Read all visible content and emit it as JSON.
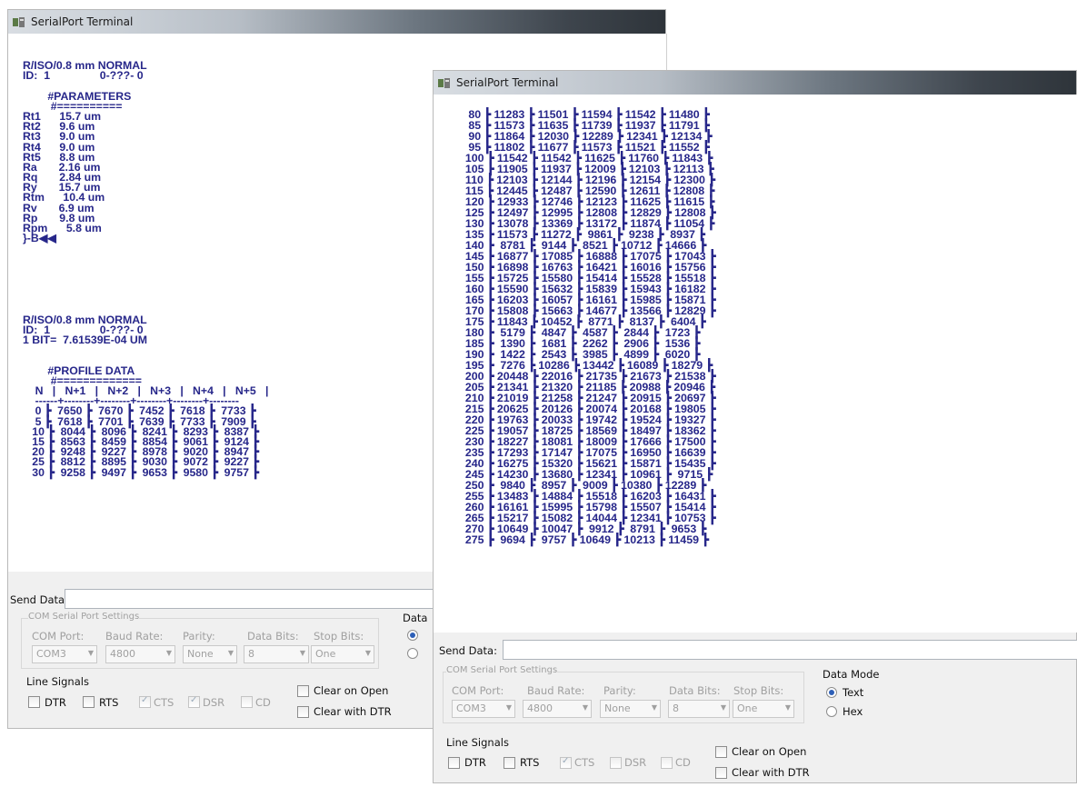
{
  "window1": {
    "title": "SerialPort Terminal",
    "terminal_lines": [
      "R/ISO/0.8 mm NORMAL",
      "ID:  1                0-???- 0",
      "",
      "        #PARAMETERS",
      "         #==========",
      "Rt1      15.7 um",
      "Rt2      9.6 um",
      "Rt3      9.0 um",
      "Rt4      9.0 um",
      "Rt5      8.8 um",
      "Ra       2.16 um",
      "Rq       2.84 um",
      "Ry       15.7 um",
      "Rtm      10.4 um",
      "Rv       6.9 um",
      "Rp       9.8 um",
      "Rpm      5.8 um",
      "}-B◀◀",
      "",
      "",
      "",
      "",
      "",
      "",
      "",
      "R/ISO/0.8 mm NORMAL",
      "ID:  1                0-???- 0",
      "1 BIT=  7.61539E-04 UM",
      "",
      "",
      "        #PROFILE DATA",
      "         #=============",
      "    N   |   N+1   |   N+2   |   N+3   |   N+4   |   N+5   |",
      "    ------+--------+--------+--------+--------+--------",
      "    0 ┣  7650 ┣  7670 ┣  7452 ┣  7618 ┣  7733 ┣",
      "    5 ┣  7618 ┣  7701 ┣  7639 ┣  7733 ┣  7909 ┣",
      "   10 ┣  8044 ┣  8096 ┣  8241 ┣  8293 ┣  8387 ┣",
      "   15 ┣  8563 ┣  8459 ┣  8854 ┣  9061 ┣  9124 ┣",
      "   20 ┣  9248 ┣  9227 ┣  8978 ┣  9020 ┣  8947 ┣",
      "   25 ┣  8812 ┣  8895 ┣  9030 ┣  9072 ┣  9227 ┣",
      "   30 ┣  9258 ┣  9497 ┣  9653 ┣  9580 ┣  9757 ┣"
    ],
    "send_data_label": "Send Data:",
    "com_group_label": "COM Serial Port Settings",
    "com_port_label": "COM Port:",
    "com_port_value": "COM3",
    "baud_label": "Baud Rate:",
    "baud_value": "4800",
    "parity_label": "Parity:",
    "parity_value": "None",
    "databits_label": "Data Bits:",
    "databits_value": "8",
    "stopbits_label": "Stop Bits:",
    "stopbits_value": "One",
    "data_mode_label": "Data",
    "line_signals_label": "Line Signals",
    "dtr": "DTR",
    "rts": "RTS",
    "cts": "CTS",
    "dsr": "DSR",
    "cd": "CD",
    "clear_open": "Clear on Open",
    "clear_dtr": "Clear with DTR"
  },
  "window2": {
    "title": "SerialPort Terminal",
    "terminal_lines": [
      "   80 ┣ 11283 ┣ 11501 ┣ 11594 ┣ 11542 ┣ 11480 ┣",
      "   85 ┣ 11573 ┣ 11635 ┣ 11739 ┣ 11937 ┣ 11791 ┣",
      "   90 ┣ 11864 ┣ 12030 ┣ 12289 ┣ 12341 ┣ 12134 ┣",
      "   95 ┣ 11802 ┣ 11677 ┣ 11573 ┣ 11521 ┣ 11552 ┣",
      "  100 ┣ 11542 ┣ 11542 ┣ 11625 ┣ 11760 ┣ 11843 ┣",
      "  105 ┣ 11905 ┣ 11937 ┣ 12009 ┣ 12103 ┣ 12113 ┣",
      "  110 ┣ 12103 ┣ 12144 ┣ 12196 ┣ 12154 ┣ 12300 ┣",
      "  115 ┣ 12445 ┣ 12487 ┣ 12590 ┣ 12611 ┣ 12808 ┣",
      "  120 ┣ 12933 ┣ 12746 ┣ 12123 ┣ 11625 ┣ 11615 ┣",
      "  125 ┣ 12497 ┣ 12995 ┣ 12808 ┣ 12829 ┣ 12808 ┣",
      "  130 ┣ 13078 ┣ 13369 ┣ 13172 ┣ 11874 ┣ 11054 ┣",
      "  135 ┣ 11573 ┣ 11272 ┣  9861 ┣  9238 ┣  8937 ┣",
      "  140 ┣  8781 ┣  9144 ┣  8521 ┣ 10712 ┣ 14666 ┣",
      "  145 ┣ 16877 ┣ 17085 ┣ 16888 ┣ 17075 ┣ 17043 ┣",
      "  150 ┣ 16898 ┣ 16763 ┣ 16421 ┣ 16016 ┣ 15756 ┣",
      "  155 ┣ 15725 ┣ 15580 ┣ 15414 ┣ 15528 ┣ 15518 ┣",
      "  160 ┣ 15590 ┣ 15632 ┣ 15839 ┣ 15943 ┣ 16182 ┣",
      "  165 ┣ 16203 ┣ 16057 ┣ 16161 ┣ 15985 ┣ 15871 ┣",
      "  170 ┣ 15808 ┣ 15663 ┣ 14677 ┣ 13566 ┣ 12829 ┣",
      "  175 ┣ 11843 ┣ 10452 ┣  8771 ┣  8137 ┣  6404 ┣",
      "  180 ┣  5179 ┣  4847 ┣  4587 ┣  2844 ┣  1723 ┣",
      "  185 ┣  1390 ┣  1681 ┣  2262 ┣  2906 ┣  1536 ┣",
      "  190 ┣  1422 ┣  2543 ┣  3985 ┣  4899 ┣  6020 ┣",
      "  195 ┣  7276 ┣ 10286 ┣ 13442 ┣ 16089 ┣ 18279 ┣",
      "  200 ┣ 20448 ┣ 22016 ┣ 21735 ┣ 21673 ┣ 21538 ┣",
      "  205 ┣ 21341 ┣ 21320 ┣ 21185 ┣ 20988 ┣ 20946 ┣",
      "  210 ┣ 21019 ┣ 21258 ┣ 21247 ┣ 20915 ┣ 20697 ┣",
      "  215 ┣ 20625 ┣ 20126 ┣ 20074 ┣ 20168 ┣ 19805 ┣",
      "  220 ┣ 19763 ┣ 20033 ┣ 19742 ┣ 19524 ┣ 19327 ┣",
      "  225 ┣ 19057 ┣ 18725 ┣ 18569 ┣ 18497 ┣ 18362 ┣",
      "  230 ┣ 18227 ┣ 18081 ┣ 18009 ┣ 17666 ┣ 17500 ┣",
      "  235 ┣ 17293 ┣ 17147 ┣ 17075 ┣ 16950 ┣ 16639 ┣",
      "  240 ┣ 16275 ┣ 15320 ┣ 15621 ┣ 15871 ┣ 15435 ┣",
      "  245 ┣ 14230 ┣ 13680 ┣ 12341 ┣ 10961 ┣  9715 ┣",
      "  250 ┣  9840 ┣  8957 ┣  9009 ┣ 10380 ┣ 12289 ┣",
      "  255 ┣ 13483 ┣ 14884 ┣ 15518 ┣ 16203 ┣ 16431 ┣",
      "  260 ┣ 16161 ┣ 15995 ┣ 15798 ┣ 15507 ┣ 15414 ┣",
      "  265 ┣ 15217 ┣ 15082 ┣ 14044 ┣ 12341 ┣ 10753 ┣",
      "  270 ┣ 10649 ┣ 10047 ┣  9912 ┣  8791 ┣  9653 ┣",
      "  275 ┣  9694 ┣  9757 ┣ 10649 ┣ 10213 ┣ 11459 ┣"
    ],
    "send_data_label": "Send Data:",
    "com_group_label": "COM Serial Port Settings",
    "com_port_label": "COM Port:",
    "com_port_value": "COM3",
    "baud_label": "Baud Rate:",
    "baud_value": "4800",
    "parity_label": "Parity:",
    "parity_value": "None",
    "databits_label": "Data Bits:",
    "databits_value": "8",
    "stopbits_label": "Stop Bits:",
    "stopbits_value": "One",
    "data_mode_label": "Data Mode",
    "mode_text": "Text",
    "mode_hex": "Hex",
    "line_signals_label": "Line Signals",
    "dtr": "DTR",
    "rts": "RTS",
    "cts": "CTS",
    "dsr": "DSR",
    "cd": "CD",
    "clear_open": "Clear on Open",
    "clear_dtr": "Clear with DTR"
  },
  "colors": {
    "terminal_text": "#27278a",
    "title_gradient_end": "#2e343a"
  }
}
